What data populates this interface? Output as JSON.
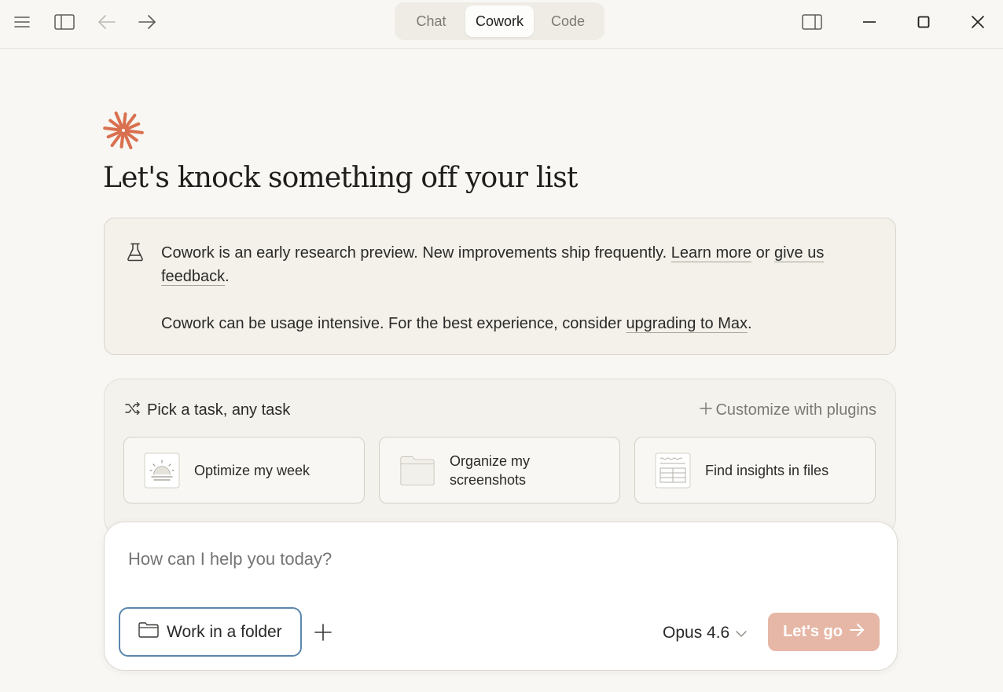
{
  "titlebar": {
    "modes": [
      {
        "label": "Chat",
        "active": false
      },
      {
        "label": "Cowork",
        "active": true
      },
      {
        "label": "Code",
        "active": false
      }
    ],
    "icons": [
      "menu-icon",
      "sidebar-toggle-icon",
      "back-arrow-icon",
      "forward-arrow-icon",
      "panel-toggle-icon",
      "minimize-icon",
      "maximize-icon",
      "close-icon"
    ]
  },
  "hero": {
    "logo_color": "#d9704f",
    "headline": "Let's knock something off your list"
  },
  "notice": {
    "line1_text": "Cowork is an early research preview. New improvements ship frequently. ",
    "learn_more": "Learn more",
    "or": " or ",
    "feedback": "give us feedback",
    "period1": ".",
    "line2_text": "Cowork can be usage intensive. For the best experience, consider ",
    "upgrade": "upgrading to Max",
    "period2": "."
  },
  "tasks": {
    "title": "Pick a task, any task",
    "customize": "Customize with plugins",
    "cards": [
      {
        "label": "Optimize my week",
        "icon": "sunrise-calendar-icon"
      },
      {
        "label": "Organize my screenshots",
        "icon": "folder-icon"
      },
      {
        "label": "Find insights in files",
        "icon": "spreadsheet-icon"
      }
    ]
  },
  "composer": {
    "placeholder": "How can I help you today?",
    "folder_button": "Work in a folder",
    "model": "Opus 4.6",
    "submit": "Let's go"
  },
  "colors": {
    "accent": "#d9704f",
    "submit_bg": "#e6b7a6",
    "folder_border": "#5b86ad",
    "background": "#f8f7f3"
  }
}
